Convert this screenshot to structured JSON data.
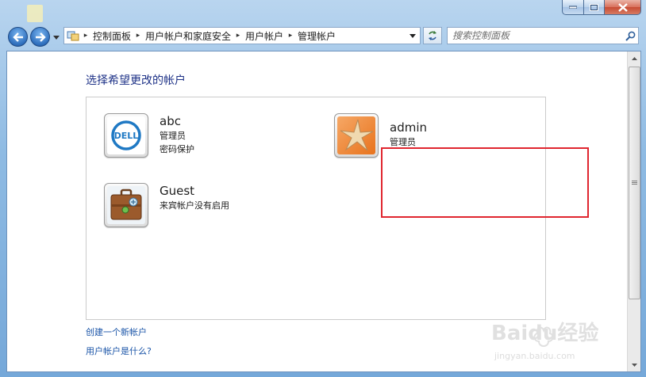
{
  "window": {
    "title": "",
    "captions": {
      "minimize": "minimize-icon",
      "maximize": "maximize-icon",
      "close": "close-icon"
    }
  },
  "nav": {
    "breadcrumb": [
      "控制面板",
      "用户帐户和家庭安全",
      "用户帐户",
      "管理帐户"
    ]
  },
  "search": {
    "placeholder": "搜索控制面板"
  },
  "main": {
    "heading": "选择希望更改的帐户",
    "accounts": [
      {
        "name": "abc",
        "type": "管理员",
        "status": "密码保护",
        "avatar": "dell-logo"
      },
      {
        "name": "admin",
        "type": "管理员",
        "avatar": "starfish-picture"
      },
      {
        "name": "Guest",
        "type": "来宾帐户没有启用",
        "avatar": "briefcase-picture"
      }
    ],
    "links": [
      "创建一个新帐户",
      "用户帐户是什么?"
    ]
  },
  "watermark": {
    "brand": "Baidu经验",
    "url": "jingyan.baidu.com"
  },
  "colors": {
    "heading": "#1e3287",
    "link": "#1b55a8",
    "highlight": "#e0262f",
    "frame": "#8fbbe3"
  }
}
